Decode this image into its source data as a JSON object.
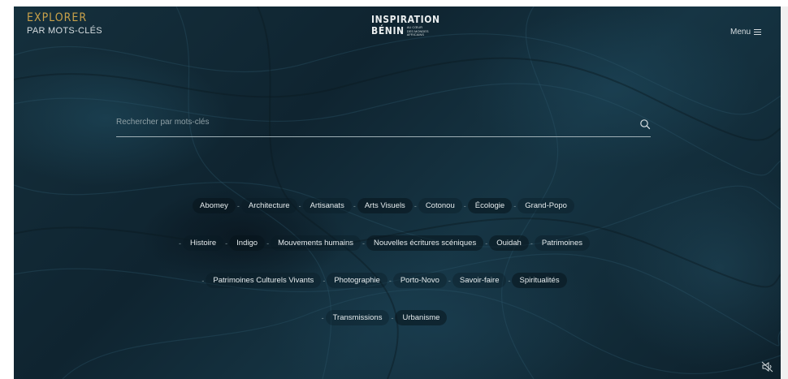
{
  "header": {
    "explore_title": "EXPLORER",
    "explore_subtitle": "PAR MOTS-CLÉS",
    "logo_line1": "INSPIRATION",
    "logo_line2": "BÉNIN",
    "logo_tagline_1": "AU CŒUR",
    "logo_tagline_2": "DES MONDES",
    "logo_tagline_3": "AFRICAINS",
    "menu_label": "Menu"
  },
  "search": {
    "placeholder": "Rechercher par mots-clés",
    "value": ""
  },
  "tag_rows": [
    [
      "Abomey",
      "Architecture",
      "Artisanats",
      "Arts Visuels",
      "Cotonou",
      "Écologie",
      "Grand-Popo"
    ],
    [
      "Histoire",
      "Indigo",
      "Mouvements humains",
      "Nouvelles écritures scéniques",
      "Ouidah",
      "Patrimoines"
    ],
    [
      "Patrimoines Culturels Vivants",
      "Photographie",
      "Porto-Novo",
      "Savoir-faire",
      "Spiritualités"
    ],
    [
      "Transmissions",
      "Urbanisme"
    ]
  ],
  "colors": {
    "accent": "#c9a24a",
    "background": "#11283a",
    "text": "#e6ecee"
  },
  "icons": {
    "menu": "hamburger-icon",
    "search": "search-icon",
    "sound": "sound-muted-icon"
  }
}
